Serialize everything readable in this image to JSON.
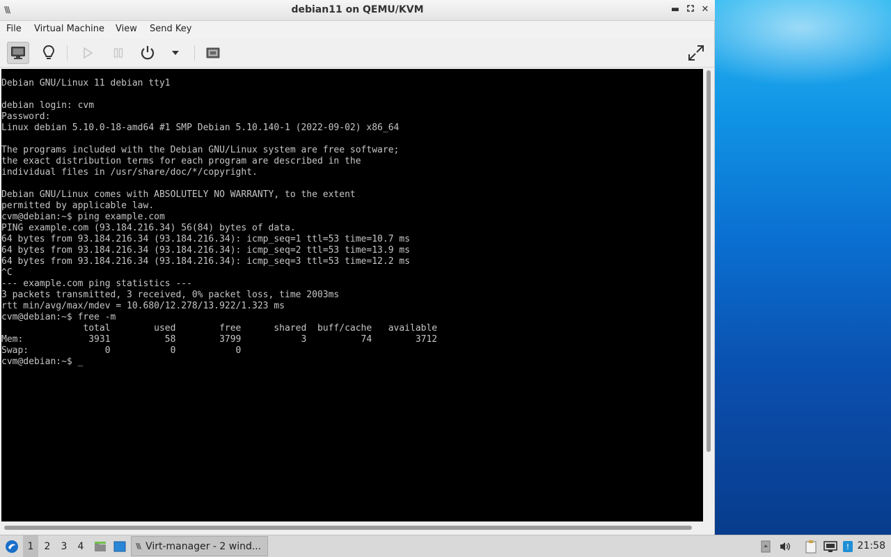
{
  "window": {
    "title": "debian11 on QEMU/KVM",
    "menu": [
      "File",
      "Virtual Machine",
      "View",
      "Send Key"
    ]
  },
  "console": {
    "lines": [
      "Debian GNU/Linux 11 debian tty1",
      "",
      "debian login: cvm",
      "Password:",
      "Linux debian 5.10.0-18-amd64 #1 SMP Debian 5.10.140-1 (2022-09-02) x86_64",
      "",
      "The programs included with the Debian GNU/Linux system are free software;",
      "the exact distribution terms for each program are described in the",
      "individual files in /usr/share/doc/*/copyright.",
      "",
      "Debian GNU/Linux comes with ABSOLUTELY NO WARRANTY, to the extent",
      "permitted by applicable law.",
      "cvm@debian:~$ ping example.com",
      "PING example.com (93.184.216.34) 56(84) bytes of data.",
      "64 bytes from 93.184.216.34 (93.184.216.34): icmp_seq=1 ttl=53 time=10.7 ms",
      "64 bytes from 93.184.216.34 (93.184.216.34): icmp_seq=2 ttl=53 time=13.9 ms",
      "64 bytes from 93.184.216.34 (93.184.216.34): icmp_seq=3 ttl=53 time=12.2 ms",
      "^C",
      "--- example.com ping statistics ---",
      "3 packets transmitted, 3 received, 0% packet loss, time 2003ms",
      "rtt min/avg/max/mdev = 10.680/12.278/13.922/1.323 ms",
      "cvm@debian:~$ free -m",
      "               total        used        free      shared  buff/cache   available",
      "Mem:            3931          58        3799           3          74        3712",
      "Swap:              0           0           0",
      "cvm@debian:~$ _"
    ]
  },
  "taskbar": {
    "workspaces": [
      "1",
      "2",
      "3",
      "4"
    ],
    "active_workspace": "1",
    "task_label": "Virt-manager - 2 wind...",
    "clock": "21:58"
  }
}
